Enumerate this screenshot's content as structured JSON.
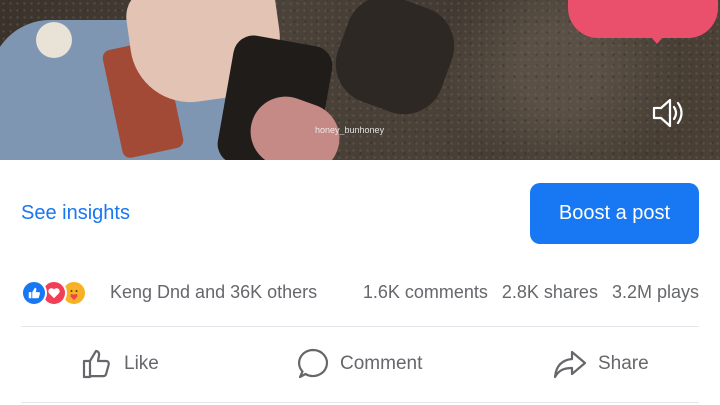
{
  "video": {
    "watermark": "honey_bunhoney",
    "sound_icon": "speaker-icon"
  },
  "actions_top": {
    "insights_label": "See insights",
    "boost_label": "Boost a post"
  },
  "reactions": {
    "icons": [
      "like-reaction-icon",
      "love-reaction-icon",
      "care-reaction-icon"
    ],
    "people_text": "Keng Dnd and 36K others",
    "comments": "1.6K comments",
    "shares": "2.8K shares",
    "plays": "3.2M plays"
  },
  "action_bar": {
    "like_label": "Like",
    "comment_label": "Comment",
    "share_label": "Share"
  },
  "colors": {
    "accent": "#1877f2",
    "muted_text": "#65676b",
    "divider": "#e4e6eb",
    "heart_bubble": "#ea4f6b"
  }
}
